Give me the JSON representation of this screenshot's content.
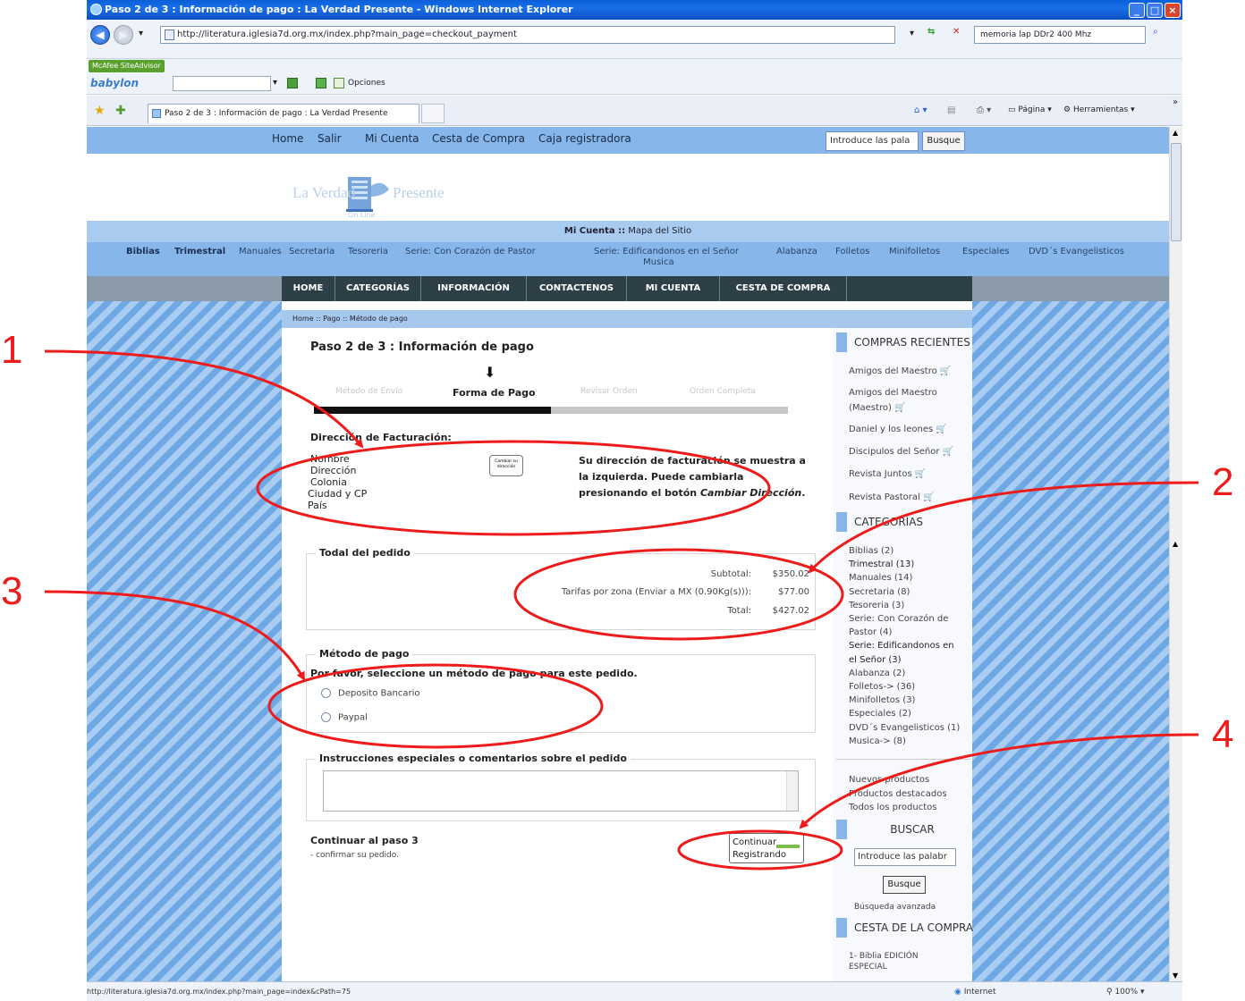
{
  "window": {
    "title": "Paso 2 de 3 : Información de pago : La Verdad Presente - Windows Internet Explorer",
    "url": "http://literatura.iglesia7d.org.mx/index.php?main_page=checkout_payment",
    "search_value": "memoria lap DDr2 400 Mhz",
    "tab_title": "Paso 2 de 3 : Información de pago : La Verdad Presente",
    "toolbar_options": "Opciones",
    "toolbar_pagina": "Página",
    "toolbar_herramientas": "Herramientas",
    "mcafee": "McAfee SiteAdvisor",
    "babylon": "babylon",
    "status_url": "http://literatura.iglesia7d.org.mx/index.php?main_page=index&cPath=75",
    "status_zone": "Internet",
    "zoom": "100%"
  },
  "topnav": {
    "home": "Home",
    "salir": "Salir",
    "mi_cuenta": "Mi Cuenta",
    "cesta": "Cesta de Compra",
    "caja": "Caja registradora",
    "search_placeholder": "Introduce las pala",
    "search_button": "Busque"
  },
  "logo": {
    "line1": "La Verdad",
    "line2": "Presente",
    "line3": "On Line"
  },
  "account_bar": {
    "mi_cuenta": "Mi Cuenta ::",
    "mapa": "Mapa del Sitio"
  },
  "categories_bar": [
    "Biblias",
    "Trimestral",
    "Manuales",
    "Secretaria",
    "Tesoreria",
    "Serie: Con Corazón de Pastor",
    "Serie: Edificandonos en el Señor",
    "Musica",
    "Alabanza",
    "Folletos",
    "Minifolletos",
    "Especiales",
    "DVD´s Evangelisticos"
  ],
  "main_menu": [
    "HOME",
    "CATEGORÍAS",
    "INFORMACIÓN",
    "CONTACTENOS",
    "MI CUENTA",
    "CESTA DE COMPRA"
  ],
  "breadcrumb": "Home  ::  Pago  :: Método de pago",
  "checkout": {
    "title": "Paso 2 de 3 : Información de pago",
    "steps": [
      "Método de Envío",
      "Forma de Pago",
      "Revisar Orden",
      "Orden Completa"
    ],
    "progress_fraction": 0.5,
    "billing_heading": "Dirección de Facturación:",
    "address_lines": [
      "Nombre",
      "Dirección",
      "Colonia",
      "Ciudad y CP",
      "País"
    ],
    "change_address_button": "Cambiar su dirección",
    "billing_note_a": "Su dirección de facturación se muestra a la izquierda. Puede cambiarla presionando el botón ",
    "billing_note_b": "Cambiar Dirección",
    "billing_note_c": ".",
    "order_total_legend": "Todal del pedido",
    "subtotal_label": "Subtotal:",
    "subtotal_value": "$350.02",
    "shipping_label": "Tarifas por zona (Enviar a MX (0.90Kg(s))):",
    "shipping_value": "$77.00",
    "total_label": "Total:",
    "total_value": "$427.02",
    "payment_legend": "Método de pago",
    "payment_prompt": "Por favor, seleccione un método de pago para este pedido.",
    "payment_options": [
      "Deposito Bancario",
      "Paypal"
    ],
    "comments_legend": "Instrucciones especiales o comentarios sobre el pedido",
    "continue_title": "Continuar al paso 3",
    "continue_sub": "- confirmar su pedido.",
    "continue_button_1": "Continuar",
    "continue_button_2": "Registrando"
  },
  "sidebar": {
    "recent_heading": "COMPRAS RECIENTES",
    "recent_items": [
      "Amigos del Maestro",
      "Amigos del Maestro (Maestro)",
      "Daniel y los leones",
      "Discipulos del Señor",
      "Revista Juntos",
      "Revista Pastoral"
    ],
    "categories_heading": "CATEGORÍAS",
    "categories": [
      "Biblias (2)",
      "Trimestral (13)",
      "Manuales (14)",
      "Secretaria (8)",
      "Tesoreria (3)",
      "Serie: Con Corazón de",
      "Pastor (4)",
      "Serie: Edificandonos en",
      "el Señor (3)",
      "Alabanza (2)",
      "Folletos-> (36)",
      "Minifolletos (3)",
      "Especiales (2)",
      "DVD´s Evangelisticos (1)",
      "Musica-> (8)"
    ],
    "links": [
      "Nuevos productos",
      "Productos destacados",
      "Todos los productos"
    ],
    "search_heading": "BUSCAR",
    "search_placeholder": "Introduce las palabr",
    "search_button": "Busque",
    "advanced_search": "Búsqueda avanzada",
    "cart_heading": "CESTA DE LA COMPRA",
    "cart_item_1": "1- Biblia EDICIÓN",
    "cart_item_2": "ESPECIAL"
  },
  "annotations": [
    "1",
    "2",
    "3",
    "4"
  ],
  "annotation_color": "#ee1b1b"
}
